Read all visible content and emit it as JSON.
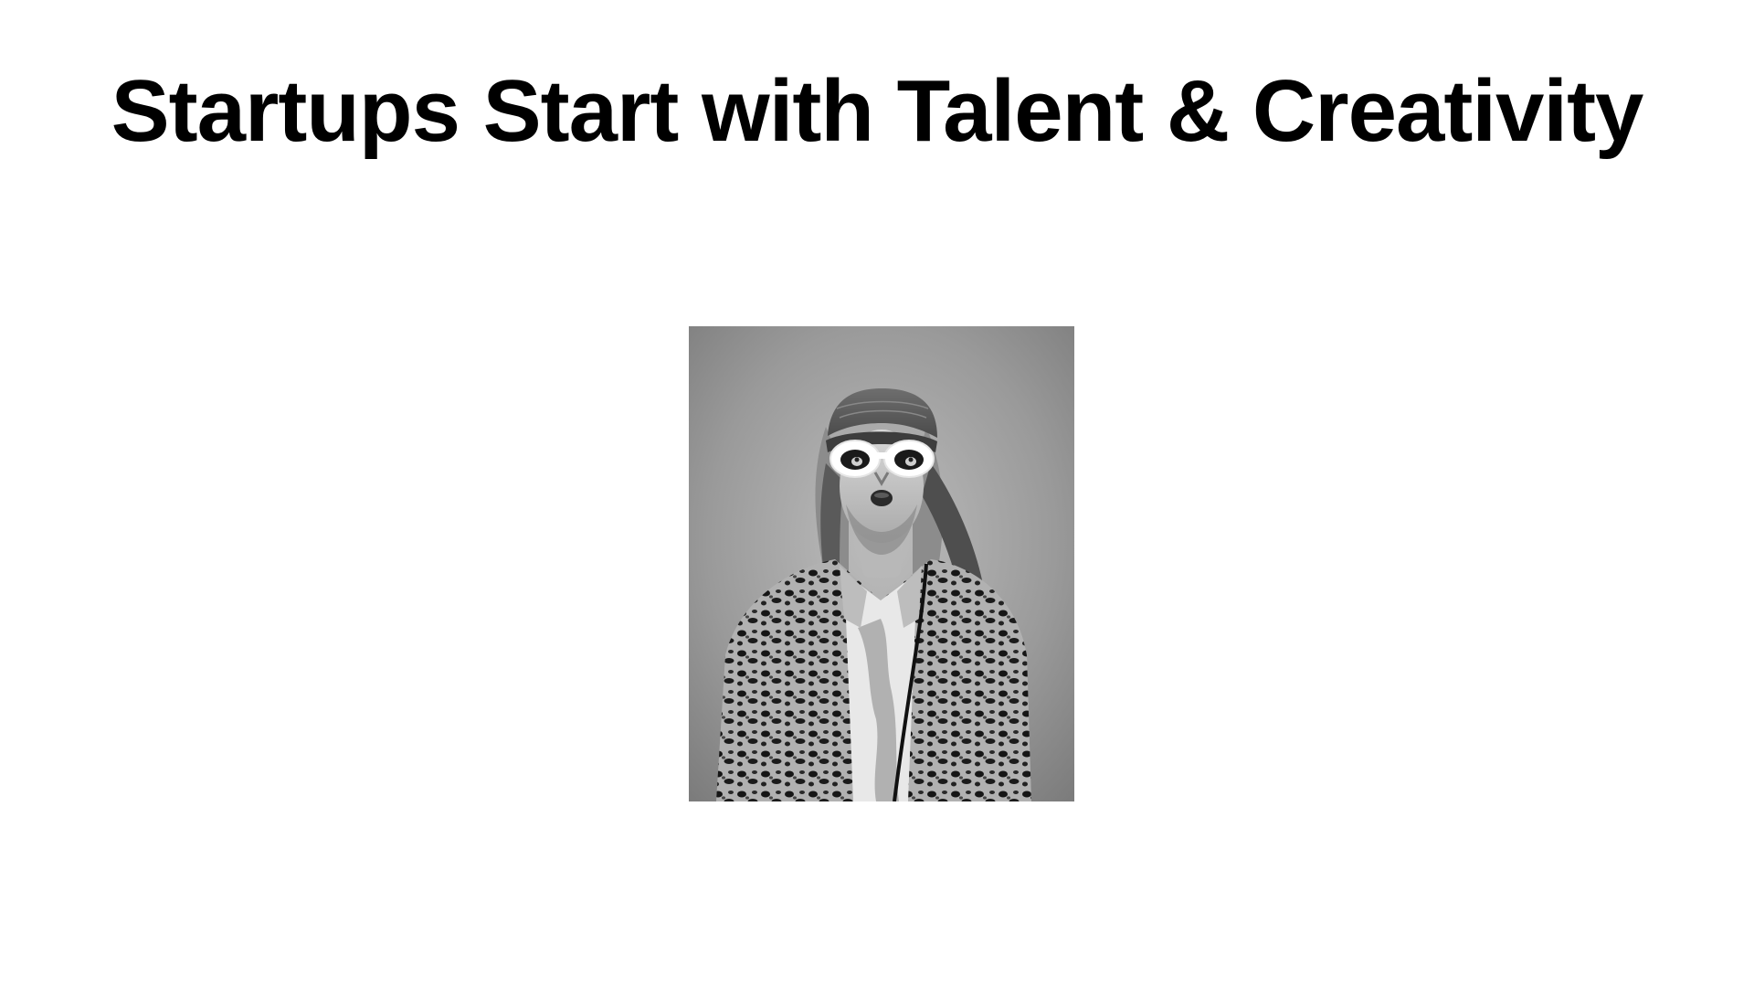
{
  "slide": {
    "title": "Startups Start with Talent & Creativity",
    "photo": {
      "subject": "portrait-photo",
      "style": "black-and-white",
      "colors": {
        "background_light": "#b9b9b9",
        "background_dark": "#7d7d7d",
        "coat": "#2a2a2a",
        "glasses": "#ffffff"
      }
    }
  }
}
